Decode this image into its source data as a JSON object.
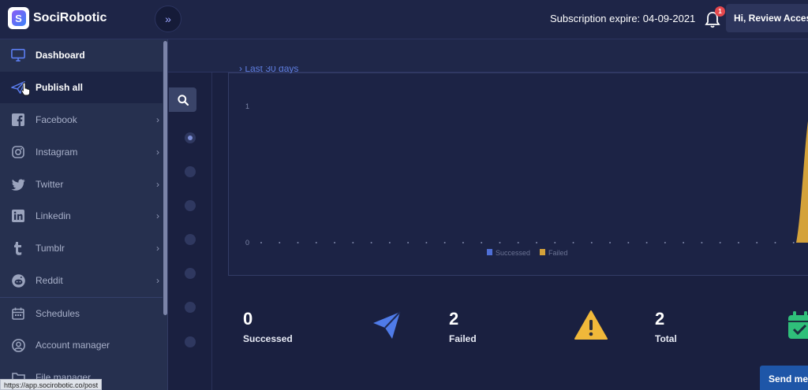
{
  "app": {
    "brand": "SociRobotic"
  },
  "header": {
    "subscription": "Subscription expire: 04-09-2021",
    "notification_count": "1",
    "user_greeting": "Hi, Review Access"
  },
  "sidebar": {
    "items": [
      {
        "label": "Dashboard",
        "icon": "monitor-icon",
        "state": "active"
      },
      {
        "label": "Publish all",
        "icon": "paper-plane-icon",
        "state": "hover"
      },
      {
        "label": "Facebook",
        "icon": "facebook-icon",
        "has_submenu": true
      },
      {
        "label": "Instagram",
        "icon": "instagram-icon",
        "has_submenu": true
      },
      {
        "label": "Twitter",
        "icon": "twitter-icon",
        "has_submenu": true
      },
      {
        "label": "Linkedin",
        "icon": "linkedin-icon",
        "has_submenu": true
      },
      {
        "label": "Tumblr",
        "icon": "tumblr-icon",
        "has_submenu": true
      },
      {
        "label": "Reddit",
        "icon": "reddit-icon",
        "has_submenu": true
      },
      {
        "label": "Schedules",
        "icon": "calendar-icon"
      },
      {
        "label": "Account manager",
        "icon": "user-circle-icon"
      },
      {
        "label": "File manager",
        "icon": "folder-icon"
      }
    ]
  },
  "status_bar": {
    "url": "https://app.socirobotic.co/post"
  },
  "chart": {
    "range_label": "› Last 30 days"
  },
  "chart_data": {
    "type": "area",
    "title": "",
    "xlabel": "",
    "ylabel": "",
    "ylim": [
      0,
      1
    ],
    "y_ticks": [
      "1",
      "0"
    ],
    "points_count": 31,
    "series": [
      {
        "name": "Successed",
        "color": "#4f6fd6",
        "values": [
          0,
          0,
          0,
          0,
          0,
          0,
          0,
          0,
          0,
          0,
          0,
          0,
          0,
          0,
          0,
          0,
          0,
          0,
          0,
          0,
          0,
          0,
          0,
          0,
          0,
          0,
          0,
          0,
          0,
          0,
          1
        ]
      },
      {
        "name": "Failed",
        "color": "#d4a23a",
        "values": [
          0,
          0,
          0,
          0,
          0,
          0,
          0,
          0,
          0,
          0,
          0,
          0,
          0,
          0,
          0,
          0,
          0,
          0,
          0,
          0,
          0,
          0,
          0,
          0,
          0,
          0,
          0,
          0,
          0,
          0,
          1
        ]
      }
    ],
    "legend": "bottom-center",
    "grid": false
  },
  "stats": [
    {
      "value": "0",
      "label": "Successed",
      "icon": "paper-plane-icon",
      "bg": "#1f2a52",
      "icon_color": "#4f7be8"
    },
    {
      "value": "2",
      "label": "Failed",
      "icon": "warning-icon",
      "bg": "#2b2c38",
      "icon_color": "#f0b83a"
    },
    {
      "value": "2",
      "label": "Total",
      "icon": "calendar-check-icon",
      "bg": "#1b2f3f",
      "icon_color": "#2fbf7a"
    }
  ],
  "actions": {
    "send_label": "Send message"
  }
}
